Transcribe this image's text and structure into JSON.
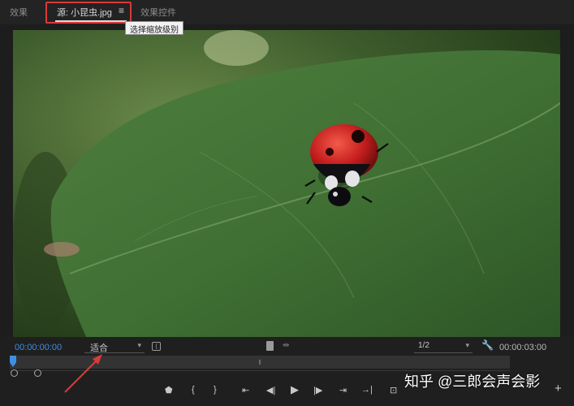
{
  "tabs": [
    {
      "label": "效果"
    },
    {
      "label": "源: 小昆虫.jpg",
      "active": true
    },
    {
      "label": "效果控件"
    }
  ],
  "tab_menu_icon": "hamburger-menu-icon",
  "highlight_color": "#d93a3a",
  "controls": {
    "timecode_current": "00:00:00:00",
    "timecode_color": "#3e8fe0",
    "zoom_select": {
      "value": "适合"
    },
    "tooltip": "选择缩放级别",
    "resolution_select": {
      "value": "1/2"
    },
    "timecode_duration": "00:00:03:00"
  },
  "transport": [
    {
      "name": "add-marker-icon",
      "glyph": "⬟"
    },
    {
      "name": "mark-in-icon",
      "glyph": "{"
    },
    {
      "name": "mark-out-icon",
      "glyph": "}"
    },
    {
      "name": "go-to-in-icon",
      "glyph": "⇤"
    },
    {
      "name": "step-back-icon",
      "glyph": "◀|"
    },
    {
      "name": "play-icon",
      "glyph": "▶"
    },
    {
      "name": "step-forward-icon",
      "glyph": "|▶"
    },
    {
      "name": "go-to-out-icon",
      "glyph": "⇥"
    },
    {
      "name": "insert-icon",
      "glyph": "⊡"
    },
    {
      "name": "overwrite-icon",
      "glyph": "⊞"
    },
    {
      "name": "export-frame-icon",
      "glyph": "◉"
    }
  ],
  "watermark": "知乎 @三郎会声会影"
}
